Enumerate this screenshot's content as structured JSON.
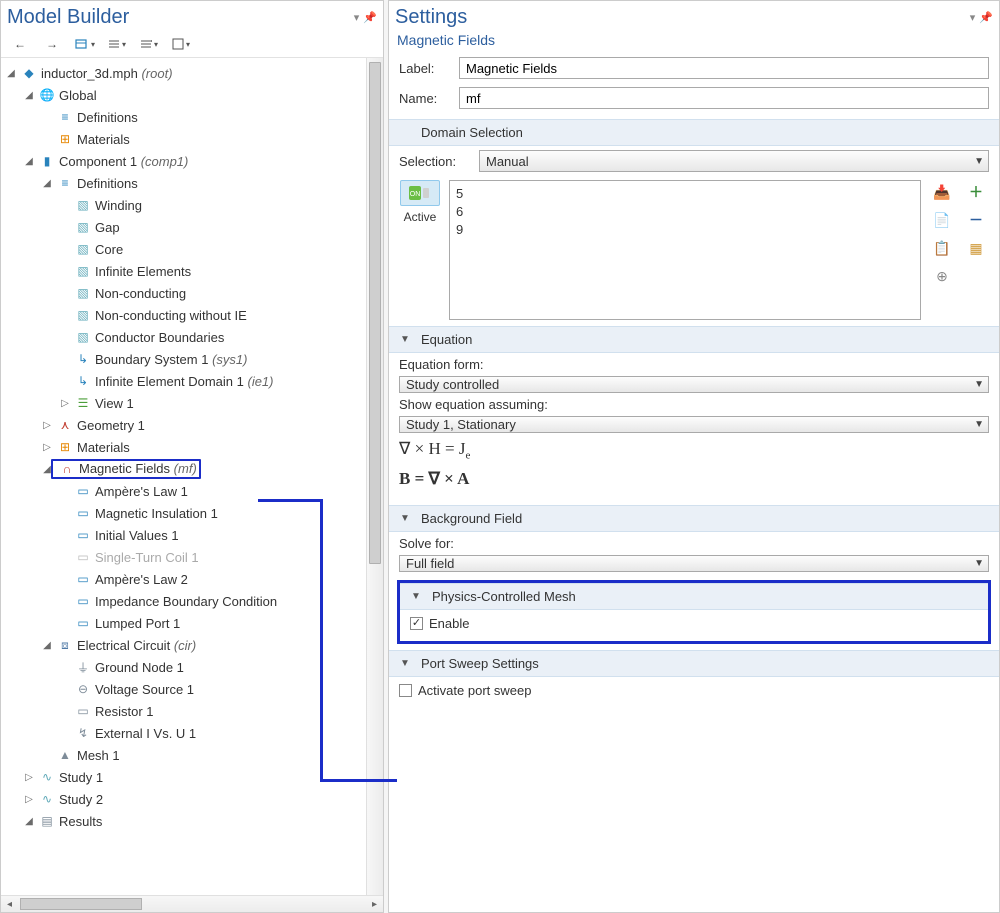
{
  "left_panel": {
    "title": "Model Builder",
    "tree": {
      "root": {
        "label": "inductor_3d.mph",
        "suffix": "(root)"
      },
      "global": "Global",
      "global_defs": "Definitions",
      "global_mats": "Materials",
      "comp": {
        "label": "Component 1",
        "suffix": "(comp1)"
      },
      "comp_defs": "Definitions",
      "sel_winding": "Winding",
      "sel_gap": "Gap",
      "sel_core": "Core",
      "sel_inf": "Infinite Elements",
      "sel_nc": "Non-conducting",
      "sel_ncie": "Non-conducting without IE",
      "sel_cb": "Conductor Boundaries",
      "bsys": {
        "label": "Boundary System 1",
        "suffix": "(sys1)"
      },
      "ied": {
        "label": "Infinite Element Domain 1",
        "suffix": "(ie1)"
      },
      "view": "View 1",
      "geom": "Geometry 1",
      "mats": "Materials",
      "mf": {
        "label": "Magnetic Fields",
        "suffix": "(mf)"
      },
      "amp1": "Ampère's Law 1",
      "mins": "Magnetic Insulation 1",
      "initv": "Initial Values 1",
      "stc": "Single-Turn Coil 1",
      "amp2": "Ampère's Law 2",
      "ibc": "Impedance Boundary Condition",
      "lport": "Lumped Port 1",
      "cir": {
        "label": "Electrical Circuit",
        "suffix": "(cir)"
      },
      "gnd": "Ground Node 1",
      "vsrc": "Voltage Source 1",
      "res": "Resistor 1",
      "ext": "External I Vs. U 1",
      "mesh": "Mesh 1",
      "study1": "Study 1",
      "study2": "Study 2",
      "results": "Results"
    }
  },
  "right_panel": {
    "title": "Settings",
    "subtitle": "Magnetic Fields",
    "label_field": {
      "caption": "Label:",
      "value": "Magnetic Fields"
    },
    "name_field": {
      "caption": "Name:",
      "value": "mf"
    },
    "domain_sel": {
      "title": "Domain Selection",
      "selection_caption": "Selection:",
      "selection_value": "Manual",
      "active_caption": "Active",
      "items": [
        "5",
        "6",
        "9"
      ]
    },
    "equation": {
      "title": "Equation",
      "form_caption": "Equation form:",
      "form_value": "Study controlled",
      "assume_caption": "Show equation assuming:",
      "assume_value": "Study 1, Stationary",
      "eq1_lhs": "∇ × H = J",
      "eq1_sub": "e",
      "eq2": "B = ∇ × A"
    },
    "bgfield": {
      "title": "Background Field",
      "solve_caption": "Solve for:",
      "solve_value": "Full field"
    },
    "phys_mesh": {
      "title": "Physics-Controlled Mesh",
      "enable": "Enable"
    },
    "port_sweep": {
      "title": "Port Sweep Settings",
      "activate": "Activate port sweep"
    }
  }
}
